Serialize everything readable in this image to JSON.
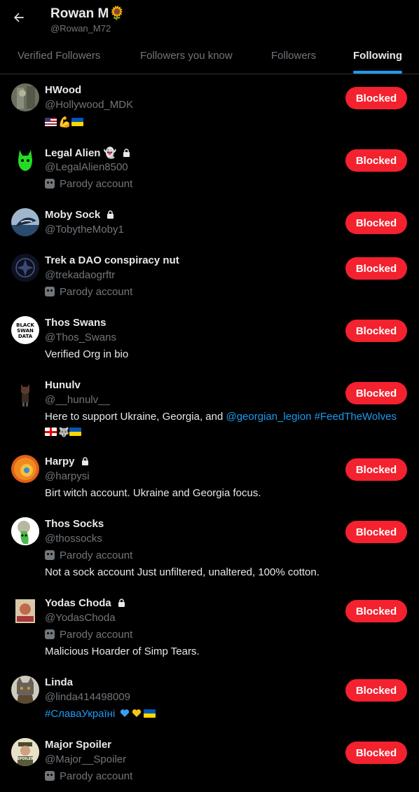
{
  "header": {
    "title": "Rowan M🌻",
    "handle": "@Rowan_M72"
  },
  "tabs": [
    {
      "label": "Verified Followers",
      "active": false
    },
    {
      "label": "Followers you know",
      "active": false
    },
    {
      "label": "Followers",
      "active": false
    },
    {
      "label": "Following",
      "active": true
    }
  ],
  "accent_color": "#1d9bf0",
  "blocked_color": "#f4212e",
  "users": [
    {
      "name": "HWood",
      "handle": "@Hollywood_MDK",
      "bio_emojis": "🇺🇸💪🇺🇦",
      "button": "Blocked"
    },
    {
      "name": "Legal Alien 👻",
      "handle": "@LegalAlien8500",
      "parody": "Parody account",
      "button": "Blocked"
    },
    {
      "name": "Moby Sock",
      "handle": "@TobytheMoby1",
      "button": "Blocked"
    },
    {
      "name": "Trek a DAO conspiracy nut",
      "handle": "@trekadaogrftr",
      "parody": "Parody account",
      "button": "Blocked"
    },
    {
      "name": "Thos Swans",
      "handle": "@Thos_Swans",
      "bio": "Verified Org in bio",
      "avatar_text": "BLACK SWAN DATA",
      "button": "Blocked"
    },
    {
      "name": "Hunulv",
      "handle": "@__hunulv__",
      "bio": "Here to support Ukraine, Georgia, and ",
      "bio_link1": "@georgian_legion",
      "bio_link2": "#FeedTheWolves",
      "button": "Blocked"
    },
    {
      "name": "Harpy",
      "handle": "@harpysi",
      "bio": "Birt witch account. Ukraine and Georgia focus.",
      "button": "Blocked"
    },
    {
      "name": "Thos Socks",
      "handle": "@thossocks",
      "parody": "Parody account",
      "bio": "Not a sock account Just unfiltered, unaltered, 100% cotton.",
      "button": "Blocked"
    },
    {
      "name": "Yodas Choda",
      "handle": "@YodasChoda",
      "parody": "Parody account",
      "bio": "Malicious Hoarder of Simp Tears.",
      "button": "Blocked"
    },
    {
      "name": "Linda",
      "handle": "@linda414498009",
      "bio_link": "#СлаваУкраїні",
      "button": "Blocked"
    },
    {
      "name": "Major Spoiler",
      "handle": "@Major__Spoiler",
      "parody": "Parody account",
      "avatar_text": "SPOILER",
      "button": "Blocked"
    }
  ]
}
